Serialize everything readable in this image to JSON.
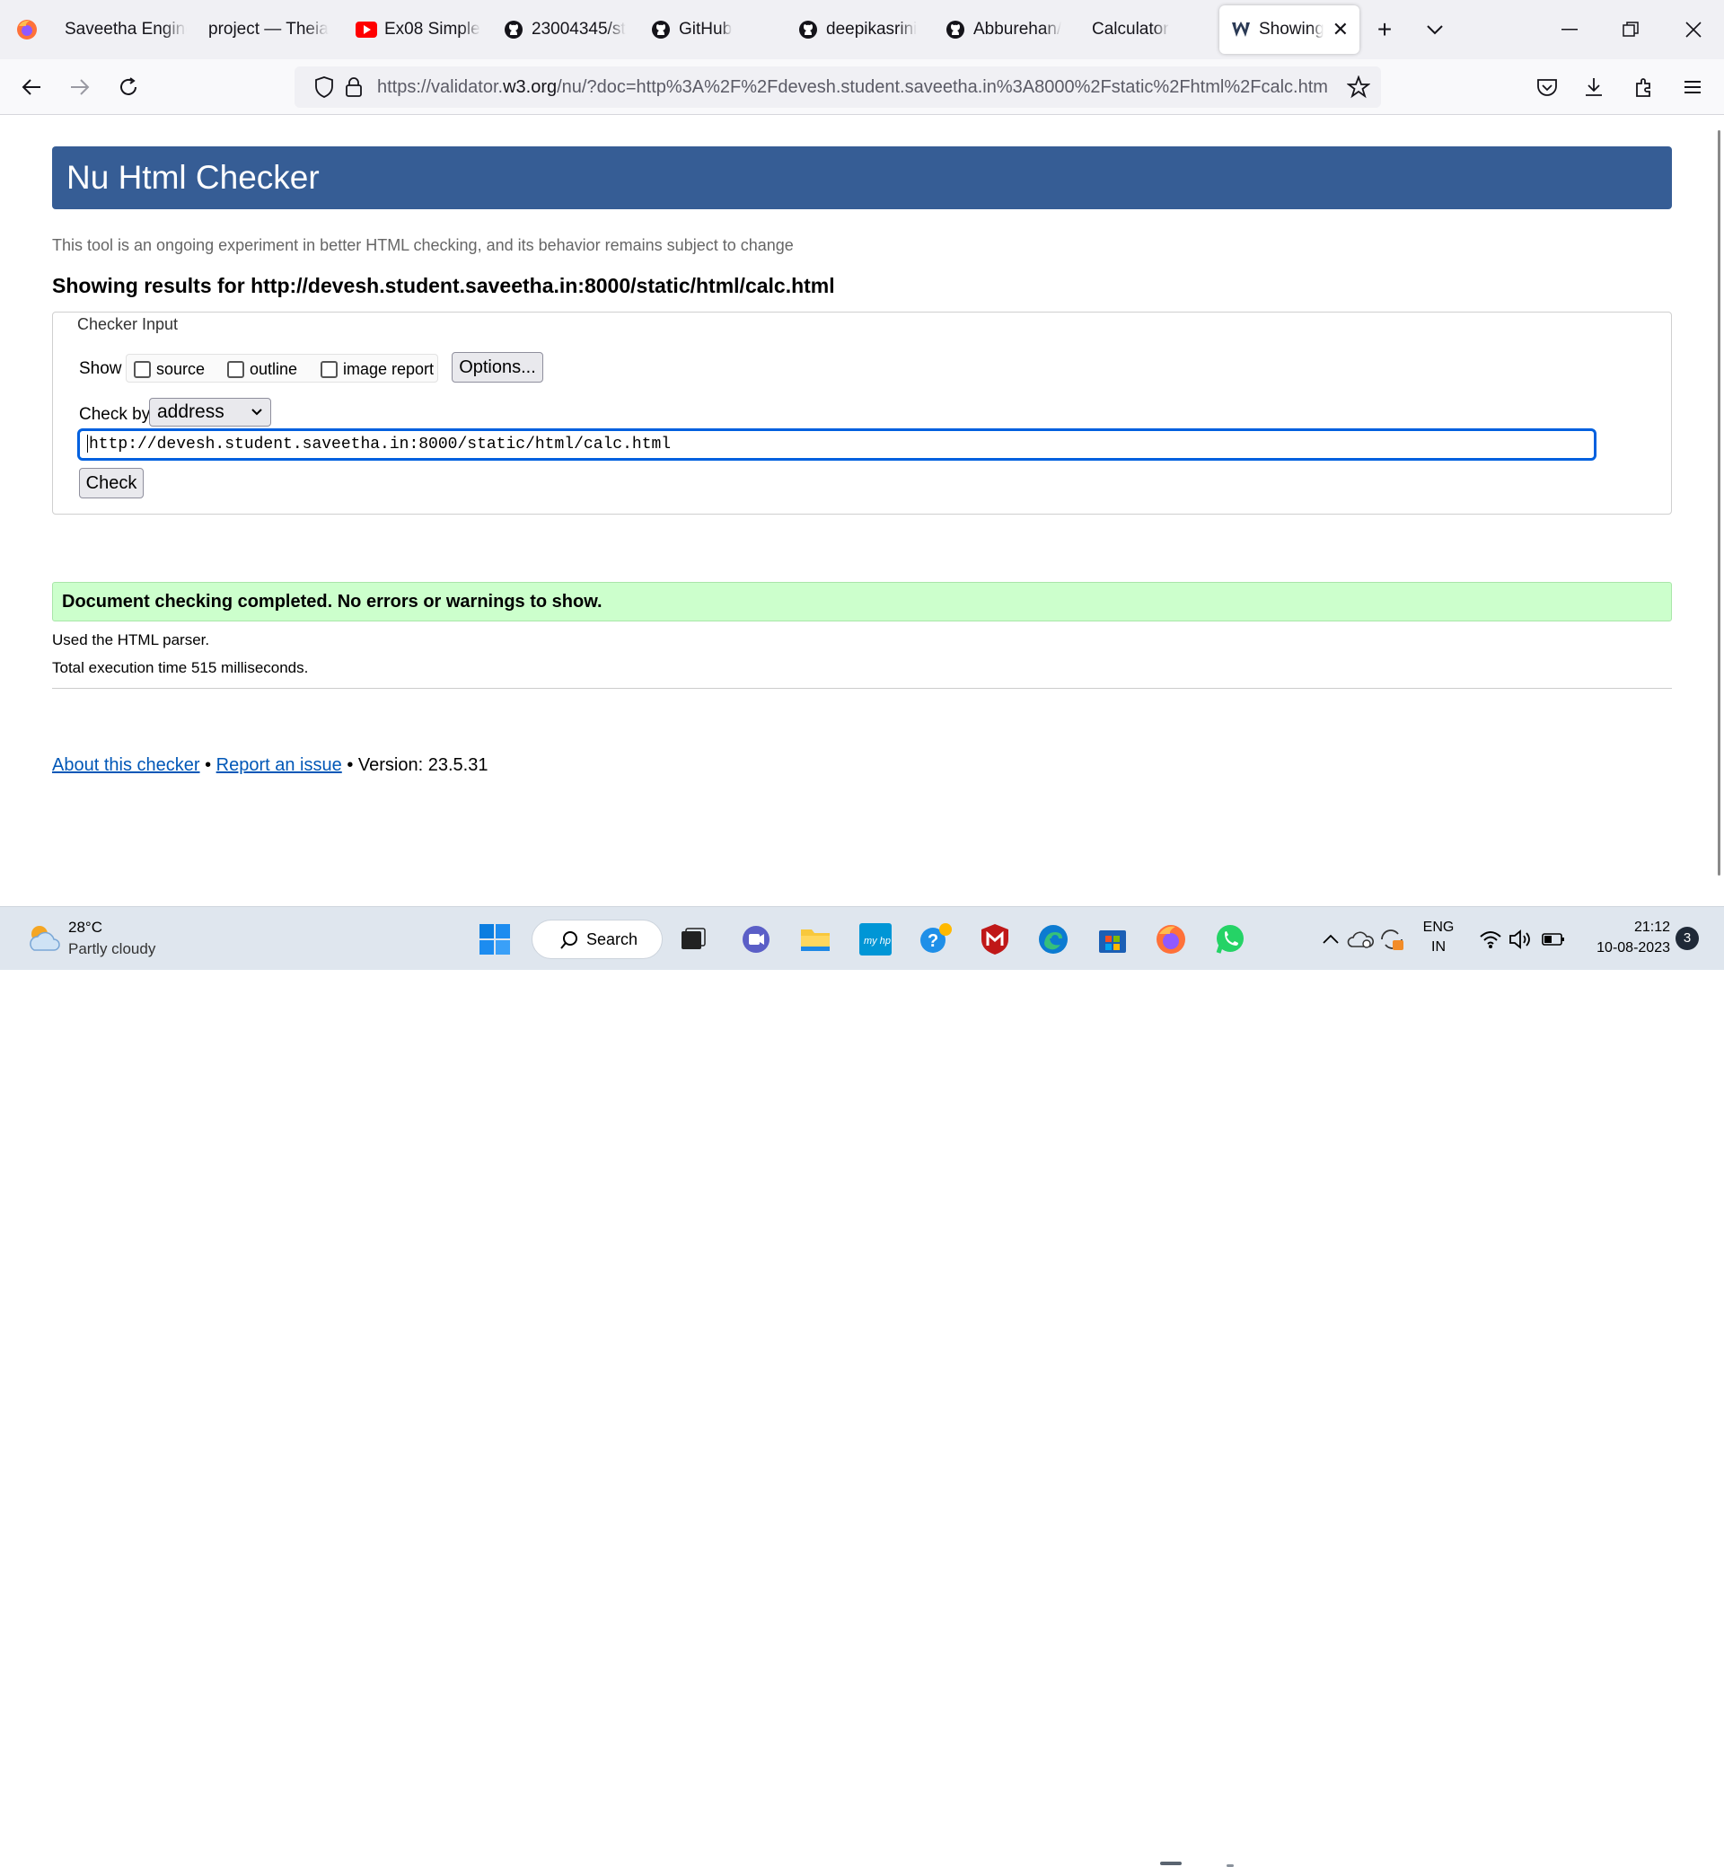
{
  "browser": {
    "tabs": [
      {
        "title": "Saveetha Engine",
        "icon": "none"
      },
      {
        "title": "project — Theia",
        "icon": "none"
      },
      {
        "title": "Ex08 Simple",
        "icon": "youtube-icon"
      },
      {
        "title": "23004345/st",
        "icon": "github-icon"
      },
      {
        "title": "GitHub",
        "icon": "github-icon"
      },
      {
        "title": "deepikasrini",
        "icon": "github-icon"
      },
      {
        "title": "Abburehan/",
        "icon": "github-icon"
      },
      {
        "title": "Calculator",
        "icon": "none"
      },
      {
        "title": "Showing",
        "icon": "w3c-icon",
        "active": true
      }
    ],
    "url": {
      "prefix": "https://validator.",
      "host": "w3.org",
      "rest": "/nu/?doc=http%3A%2F%2Fdevesh.student.saveetha.in%3A8000%2Fstatic%2Fhtml%2Fcalc.htm"
    }
  },
  "page": {
    "title": "Nu Html Checker",
    "tagline": "This tool is an ongoing experiment in better HTML checking, and its behavior remains subject to change",
    "results_heading": "Showing results for http://devesh.student.saveetha.in:8000/static/html/calc.html",
    "checker_input": {
      "legend": "Checker Input",
      "show_label": "Show",
      "checkboxes": [
        "source",
        "outline",
        "image report"
      ],
      "options_button": "Options...",
      "check_by_label": "Check by",
      "check_by_selected": "address",
      "address_value": "http://devesh.student.saveetha.in:8000/static/html/calc.html",
      "check_button": "Check"
    },
    "success_message": "Document checking completed. No errors or warnings to show.",
    "parser_info": "Used the HTML parser.",
    "execution_time": "Total execution time 515 milliseconds.",
    "footer": {
      "about_link": "About this checker",
      "separator": "•",
      "report_link": "Report an issue",
      "version": "Version: 23.5.31"
    }
  },
  "taskbar": {
    "weather_temp": "28°C",
    "weather_desc": "Partly cloudy",
    "search_label": "Search",
    "lang_top": "ENG",
    "lang_bottom": "IN",
    "time": "21:12",
    "date": "10-08-2023",
    "notification_count": "3"
  },
  "colors": {
    "header_blue": "#365d95",
    "success_green": "#ccffcc",
    "link_blue": "#0057b7",
    "focus_blue": "#0060df"
  }
}
